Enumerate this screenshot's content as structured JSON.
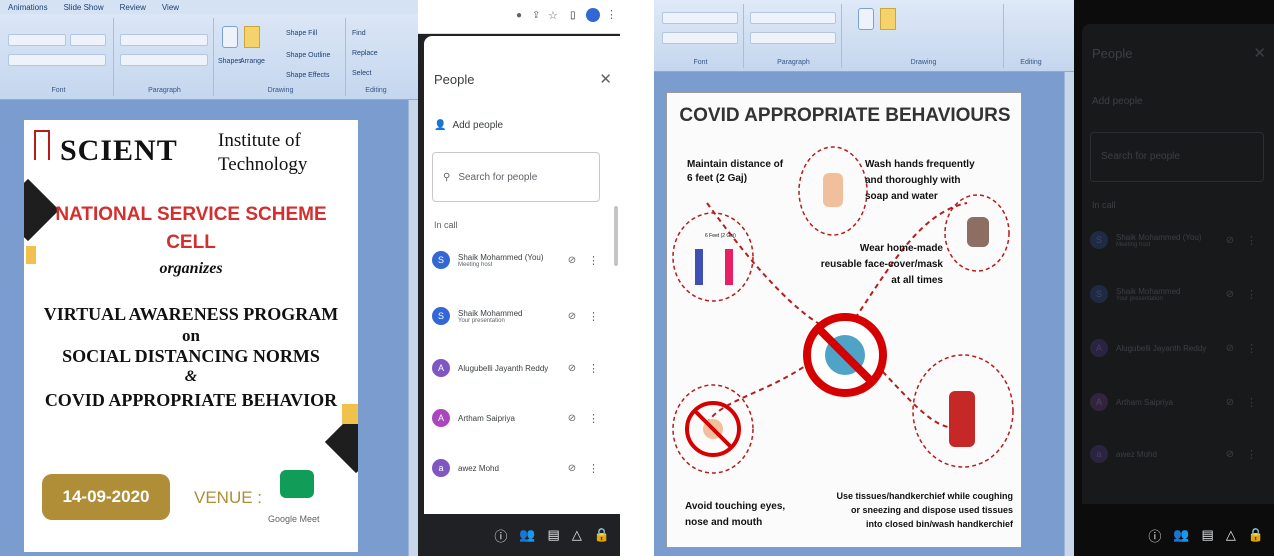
{
  "left": {
    "ribbon": {
      "tabs": [
        "Animations",
        "Slide Show",
        "Review",
        "View"
      ],
      "groups": [
        "Font",
        "Paragraph",
        "Drawing",
        "Editing"
      ],
      "drawing": {
        "shapes": "Shapes",
        "arrange": "Arrange",
        "quick_styles": "Quick Styles",
        "shape_fill": "Shape Fill",
        "shape_outline": "Shape Outline",
        "shape_effects": "Shape Effects"
      },
      "editing": {
        "find": "Find",
        "replace": "Replace",
        "select": "Select"
      }
    },
    "poster": {
      "logo_text": "SCIENT",
      "institute_line1": "Institute of",
      "institute_line2": "Technology",
      "cell_line1": "NATIONAL SERVICE SCHEME",
      "cell_line2": "CELL",
      "organizes": "organizes",
      "program_line1": "VIRTUAL AWARENESS PROGRAM",
      "program_on": "on",
      "program_line2": "SOCIAL DISTANCING NORMS",
      "ampersand": "&",
      "program_line3": "COVID APPROPRIATE BEHAVIOR",
      "date": "14-09-2020",
      "venue": "VENUE :",
      "venue_app": "Google Meet"
    },
    "meet": {
      "panel_title": "People",
      "close": "✕",
      "add_people": "Add people",
      "search_placeholder": "Search for people",
      "in_call": "In call",
      "participants": [
        {
          "initial": "S",
          "name": "Shaik Mohammed (You)",
          "sub": "Meeting host",
          "color": "#3367d6"
        },
        {
          "initial": "S",
          "name": "Shaik Mohammed",
          "sub": "Your presentation",
          "color": "#3367d6"
        },
        {
          "initial": "A",
          "name": "Alugubelli Jayanth Reddy",
          "sub": "",
          "color": "#7e57c2"
        },
        {
          "initial": "A",
          "name": "Artham Saipriya",
          "sub": "",
          "color": "#ab47bc"
        },
        {
          "initial": "a",
          "name": "awez Mohd",
          "sub": "",
          "color": "#7e57c2"
        }
      ]
    }
  },
  "right": {
    "ribbon": {
      "groups": [
        "Font",
        "Paragraph",
        "Drawing",
        "Editing"
      ]
    },
    "slide": {
      "title": "COVID APPROPRIATE BEHAVIOURS",
      "tip1_line1": "Maintain distance of",
      "tip1_line2": "6 feet (2 Gaj)",
      "tip2_line1": "Wash hands frequently",
      "tip2_line2": "and thoroughly with",
      "tip2_line3": "soap and water",
      "tip3_line1": "Wear home-made",
      "tip3_line2": "reusable face-cover/mask",
      "tip3_line3": "at all times",
      "tip4_line1": "Avoid touching eyes,",
      "tip4_line2": "nose and mouth",
      "tip5_line1": "Use tissues/handkerchief while coughing",
      "tip5_line2": "or sneezing and dispose used tissues",
      "tip5_line3": "into closed bin/wash handkerchief",
      "distance_label": "6 Feet (2 Gaj)"
    },
    "meet": {
      "panel_title": "People",
      "add_people": "Add people",
      "search_placeholder": "Search for people",
      "in_call": "In call",
      "participants": [
        {
          "initial": "S",
          "name": "Shaik Mohammed (You)",
          "sub": "Meeting host"
        },
        {
          "initial": "S",
          "name": "Shaik Mohammed",
          "sub": "Your presentation"
        },
        {
          "initial": "A",
          "name": "Alugubelli Jayanth Reddy",
          "sub": ""
        },
        {
          "initial": "A",
          "name": "Artham Saipriya",
          "sub": ""
        },
        {
          "initial": "a",
          "name": "awez Mohd",
          "sub": ""
        }
      ]
    }
  }
}
